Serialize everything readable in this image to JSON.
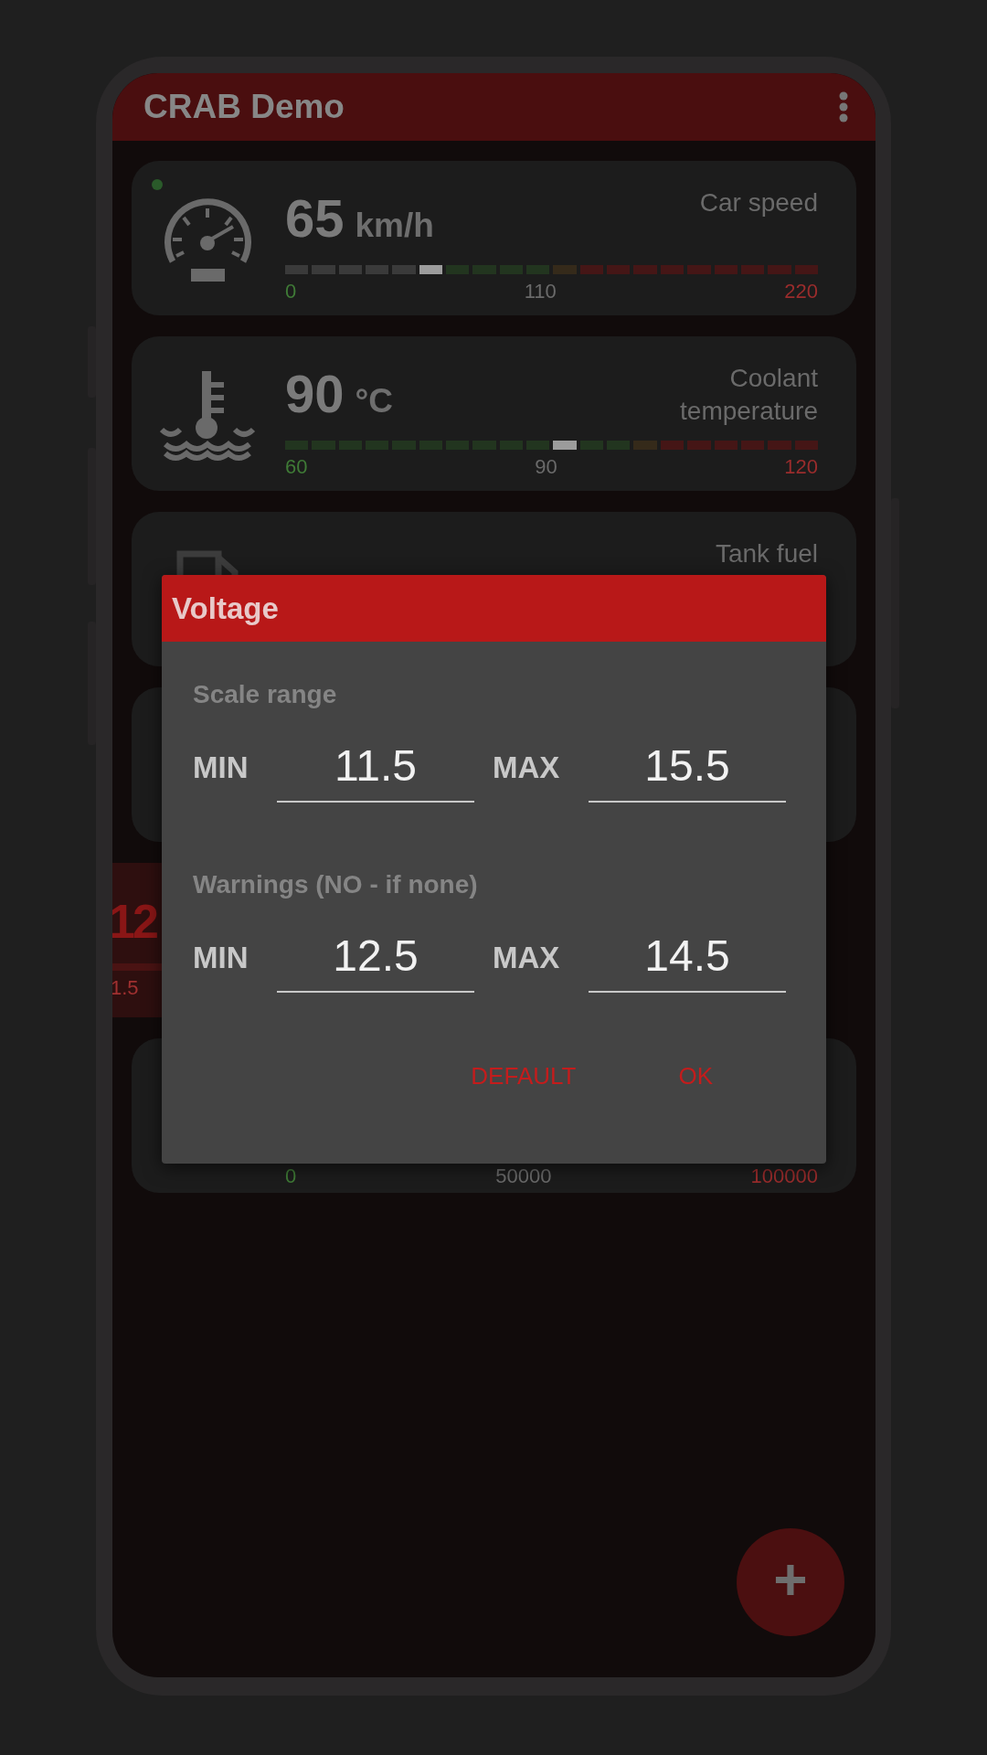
{
  "app_bar": {
    "title": "CRAB Demo"
  },
  "cards": [
    {
      "kind": "gauge",
      "color": "#2a5a2a",
      "value": "65",
      "unit": "km/h",
      "label": "Car speed",
      "segments": [
        {
          "color": "#3a3a3a"
        },
        {
          "color": "#3a3a3a"
        },
        {
          "color": "#3a3a3a"
        },
        {
          "color": "#3a3a3a"
        },
        {
          "color": "#3a3a3a"
        },
        {
          "color": "#9c9c9c"
        },
        {
          "color": "#22351f"
        },
        {
          "color": "#22351f"
        },
        {
          "color": "#22351f"
        },
        {
          "color": "#22351f"
        },
        {
          "color": "#352a1a"
        },
        {
          "color": "#451616"
        },
        {
          "color": "#451616"
        },
        {
          "color": "#451616"
        },
        {
          "color": "#451616"
        },
        {
          "color": "#451616"
        },
        {
          "color": "#451616"
        },
        {
          "color": "#451616"
        },
        {
          "color": "#451616"
        },
        {
          "color": "#451616"
        }
      ],
      "ticks": [
        {
          "label": "0",
          "color": "#3f7a36"
        },
        {
          "label": "110",
          "color": "#6a6a6a"
        },
        {
          "label": "220",
          "color": "#9a2c2c"
        }
      ]
    },
    {
      "kind": "gauge",
      "value": "90",
      "unit": "°C",
      "label": "Coolant temperature",
      "segments": [
        {
          "color": "#22351f"
        },
        {
          "color": "#22351f"
        },
        {
          "color": "#22351f"
        },
        {
          "color": "#22351f"
        },
        {
          "color": "#22351f"
        },
        {
          "color": "#22351f"
        },
        {
          "color": "#22351f"
        },
        {
          "color": "#22351f"
        },
        {
          "color": "#22351f"
        },
        {
          "color": "#22351f"
        },
        {
          "color": "#9c9c9c"
        },
        {
          "color": "#22351f"
        },
        {
          "color": "#22351f"
        },
        {
          "color": "#352a1a"
        },
        {
          "color": "#451616"
        },
        {
          "color": "#451616"
        },
        {
          "color": "#451616"
        },
        {
          "color": "#451616"
        },
        {
          "color": "#451616"
        },
        {
          "color": "#451616"
        }
      ],
      "ticks": [
        {
          "label": "60",
          "color": "#3f7a36"
        },
        {
          "label": "90",
          "color": "#6a6a6a"
        },
        {
          "label": "120",
          "color": "#9a2c2c"
        }
      ]
    },
    {
      "kind": "gauge",
      "label": "Tank fuel"
    },
    {
      "kind": "blank"
    },
    {
      "kind": "swiped",
      "value": "12",
      "tick": "1.5"
    },
    {
      "kind": "gauge",
      "ticks": [
        {
          "label": "0",
          "color": "#3f7a36"
        },
        {
          "label": "50000",
          "color": "#6a6a6a"
        },
        {
          "label": "100000",
          "color": "#9a2c2c"
        }
      ]
    }
  ],
  "dialog": {
    "title": "Voltage",
    "sections": [
      {
        "heading": "Scale range",
        "min_label": "MIN",
        "min_value": "11.5",
        "max_label": "MAX",
        "max_value": "15.5"
      },
      {
        "heading": "Warnings (NO - if none)",
        "min_label": "MIN",
        "min_value": "12.5",
        "max_label": "MAX",
        "max_value": "14.5"
      }
    ],
    "buttons": [
      "DEFAULT",
      "OK"
    ]
  },
  "fab": {
    "label": "+"
  }
}
